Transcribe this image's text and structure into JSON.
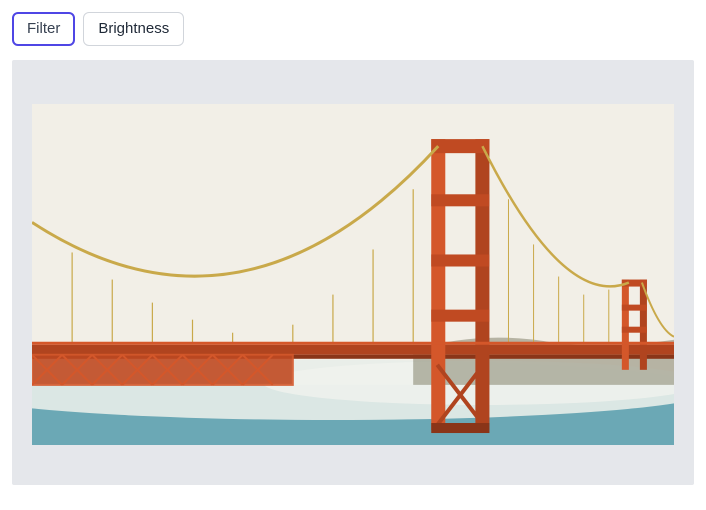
{
  "tabs": [
    {
      "label": "Filter",
      "active": true
    },
    {
      "label": "Brightness",
      "active": false
    }
  ],
  "image": {
    "alt": "Golden Gate Bridge",
    "colors": {
      "sky": "#f2efe7",
      "bridge": "#d4572a",
      "bridge_dark": "#b0441f",
      "cable": "#c9a94a",
      "water": "#6ba8b5",
      "fog": "#e8ede9",
      "hill": "#7a7860"
    }
  }
}
